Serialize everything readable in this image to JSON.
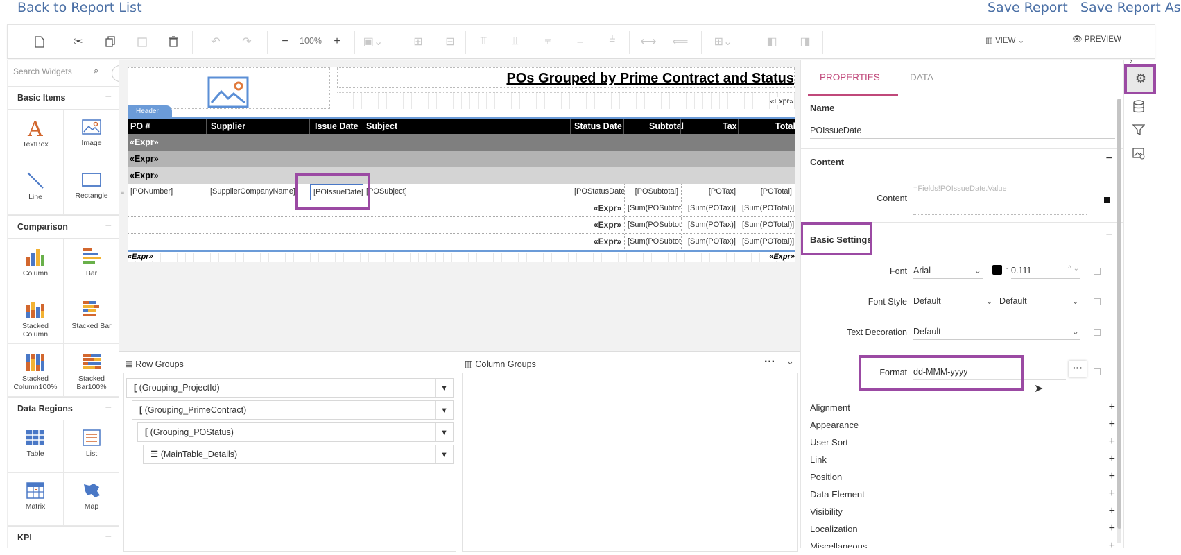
{
  "topbar": {
    "back": "Back to Report List",
    "save": "Save Report",
    "save_as": "Save Report As"
  },
  "toolbar": {
    "zoom": "100%",
    "view": "VIEW",
    "preview": "PREVIEW"
  },
  "sidebar": {
    "search_placeholder": "Search Widgets",
    "sections": {
      "basic": "Basic Items",
      "comparison": "Comparison",
      "data_regions": "Data Regions",
      "kpi": "KPI"
    },
    "widgets": {
      "textbox": "TextBox",
      "image": "Image",
      "line": "Line",
      "rectangle": "Rectangle",
      "column": "Column",
      "bar": "Bar",
      "stacked_column_1": "Stacked",
      "stacked_column_2": "Column",
      "stacked_bar": "Stacked Bar",
      "stacked_column100_1": "Stacked",
      "stacked_column100_2": "Column100%",
      "stacked_bar100_1": "Stacked",
      "stacked_bar100_2": "Bar100%",
      "table": "Table",
      "list": "List",
      "matrix": "Matrix",
      "map": "Map"
    }
  },
  "report": {
    "title": "POs Grouped by Prime Contract and Status",
    "expr": "«Expr»",
    "header_tab": "Header",
    "columns": [
      "PO #",
      "Supplier",
      "Issue Date",
      "Subject",
      "Status Date",
      "Subtotal",
      "Tax",
      "Total"
    ],
    "detail": [
      "[PONumber]",
      "[SupplierCompanyName]",
      "[POIssueDate]",
      "[POSubject]",
      "[POStatusDate]",
      "[POSubtotal]",
      "[POTax]",
      "[POTotal]"
    ],
    "sum_subtotal": "[Sum(POSubtota",
    "sum_tax": "[Sum(POTax)]",
    "sum_total": "[Sum(POTotal)]"
  },
  "groups": {
    "row_title": "Row Groups",
    "col_title": "Column Groups",
    "more": "···",
    "rows": [
      "(Grouping_ProjectId)",
      "(Grouping_PrimeContract)",
      "(Grouping_POStatus)",
      "(MainTable_Details)"
    ]
  },
  "props": {
    "tab_properties": "PROPERTIES",
    "tab_data": "DATA",
    "name_label": "Name",
    "name_value": "POIssueDate",
    "content_section": "Content",
    "content_label": "Content",
    "content_value": "=Fields!POIssueDate.Value",
    "basic_settings": "Basic Settings",
    "font_label": "Font",
    "font_value": "Arial",
    "font_size": "0.111",
    "font_style_label": "Font Style",
    "font_style_value": "Default",
    "font_weight_value": "Default",
    "text_decoration_label": "Text Decoration",
    "text_decoration_value": "Default",
    "format_label": "Format",
    "format_value": "dd-MMM-yyyy",
    "accordion": [
      "Alignment",
      "Appearance",
      "User Sort",
      "Link",
      "Position",
      "Data Element",
      "Visibility",
      "Localization",
      "Miscellaneous"
    ]
  },
  "colors": {
    "accent": "#9b4aa3",
    "tab_active": "#c0487a",
    "link": "#4a6fa5"
  }
}
